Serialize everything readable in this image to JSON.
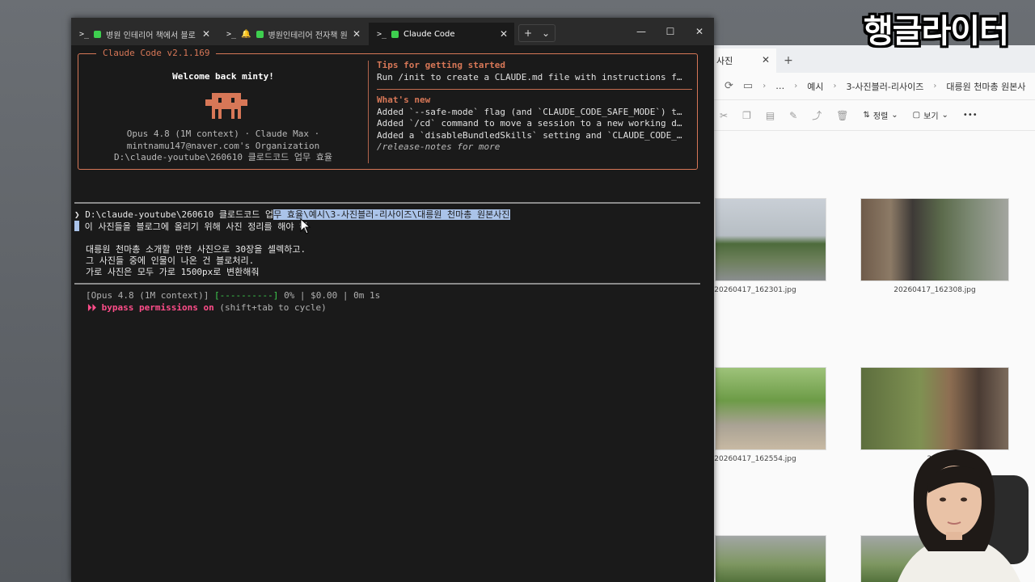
{
  "explorer": {
    "tab_label": "사진",
    "tab_close": "✕",
    "new_tab": "+",
    "breadcrumb": [
      "…",
      "예시",
      "3-사진블러-리사이즈",
      "대릉원 천마총 원본사"
    ],
    "toolbar": {
      "sort_label": "정렬",
      "view_label": "보기",
      "more": "•••"
    },
    "files": [
      {
        "name": "20260417_162301.jpg"
      },
      {
        "name": "20260417_162308.jpg"
      },
      {
        "name": "20260417_162554.jpg"
      },
      {
        "name": "2026"
      }
    ]
  },
  "terminal": {
    "tabs": [
      {
        "label": "병원 인테리어 책에서 블로"
      },
      {
        "label": "병원인테리어 전자책 원"
      },
      {
        "label": "Claude Code"
      }
    ],
    "tab_close": "✕",
    "new_tab": "+",
    "dropdown": "⌄",
    "controls": {
      "minimize": "—",
      "maximize": "☐",
      "close": "✕"
    },
    "welcome": {
      "box_title": "Claude Code v2.1.169",
      "greeting": "Welcome back minty!",
      "model_line": "Opus 4.8 (1M context) · Claude Max ·",
      "org_line": "mintnamu147@naver.com's Organization",
      "path_line": "D:\\claude-youtube\\260610 클로드코드 업무 효율"
    },
    "tips": {
      "heading": "Tips for getting started",
      "text": "Run /init to create a CLAUDE.md file with instructions f…"
    },
    "whats_new": {
      "heading": "What's new",
      "items": [
        "Added `--safe-mode` flag (and `CLAUDE_CODE_SAFE_MODE`) t…",
        "Added `/cd` command to move a session to a new working d…",
        "Added a `disableBundledSkills` setting and `CLAUDE_CODE_…"
      ],
      "footer": "/release-notes for more"
    },
    "prompt": {
      "symbol": "❯",
      "line1_plain": "D:\\claude-youtube\\260610 클로드코드 업",
      "line1_selected": "무 효율\\예시\\3-사진블러-리사이즈\\대릉원 천마총 원본사진",
      "line2": "이 사진들을 블로그에 올리기 위해 사진 정리를 해야 해",
      "line3": "대릉원 천마총 소개할 만한 사진으로 30장을 셀렉하고.",
      "line4": "그 사진들 중에 인물이 나온 건 블로처리.",
      "line5": "가로 사진은 모두 가로 1500px로 변환해줘"
    },
    "status": {
      "model": "[Opus 4.8 (1M context)]",
      "progress": "[----------]",
      "rest": "0% | $0.00 | 0m 1s"
    },
    "bypass": {
      "arrows": "⏵⏵",
      "label": "bypass permissions on",
      "hint": "(shift+tab to cycle)"
    }
  },
  "overlay": {
    "logo_text": "행글라이터"
  },
  "colors": {
    "accent": "#d77757",
    "green": "#3ecf4f",
    "pink": "#ff4d8a",
    "selection": "#aac3e9"
  }
}
